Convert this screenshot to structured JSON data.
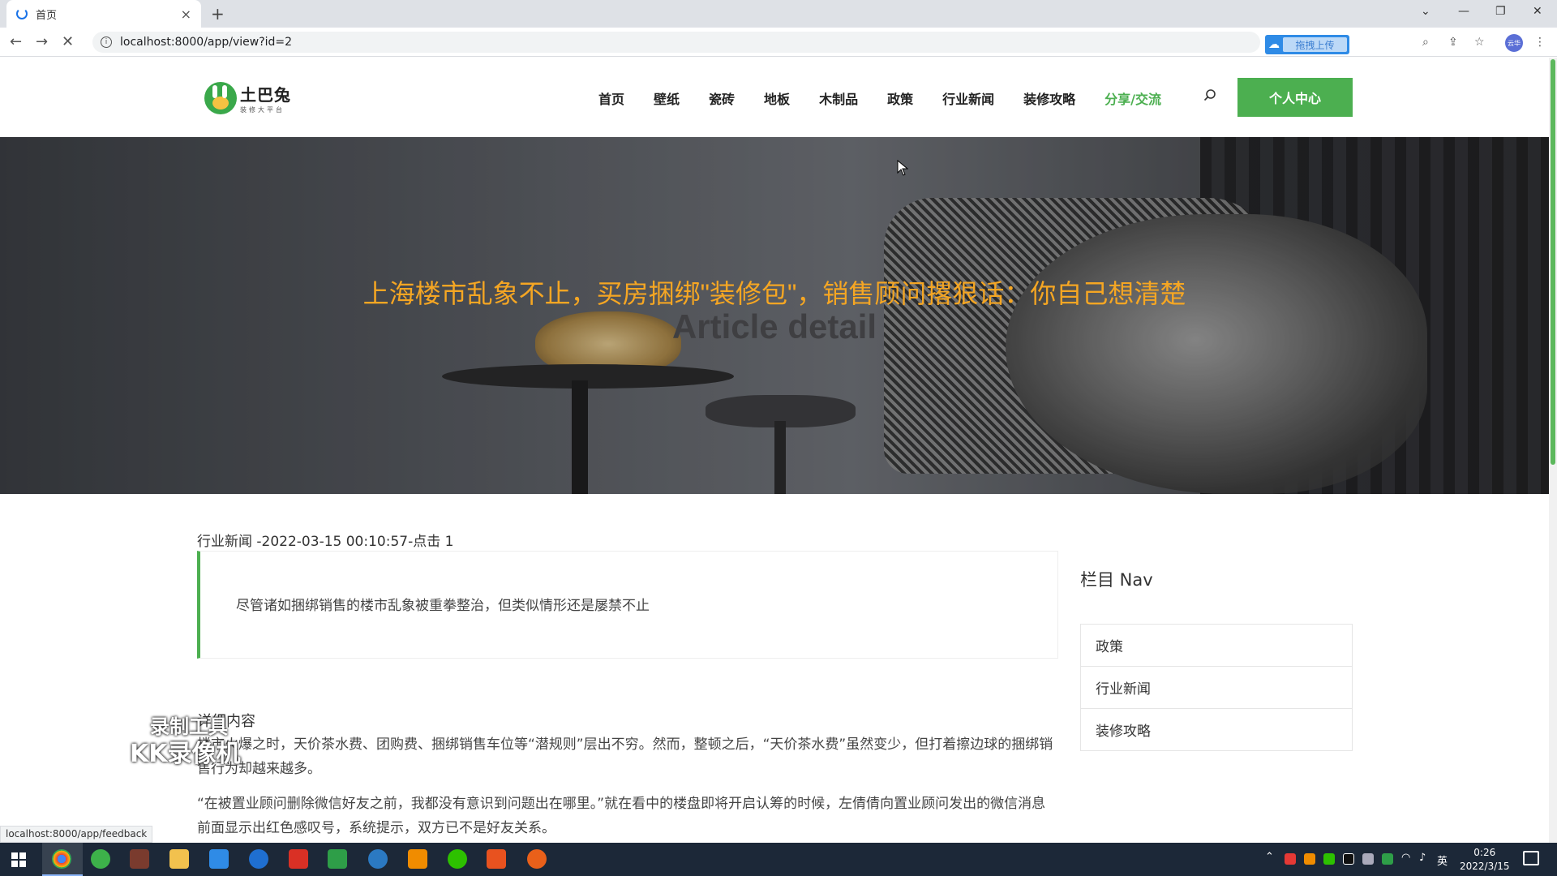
{
  "browser": {
    "tab_title": "首页",
    "tab_close": "×",
    "new_tab": "+",
    "url": "localhost:8000/app/view?id=2",
    "upload_label": "拖拽上传",
    "avatar_text": "云华",
    "status_url": "localhost:8000/app/feedback"
  },
  "site": {
    "logo_name": "土巴兔",
    "logo_sub": "装修大平台",
    "nav": [
      "首页",
      "壁纸",
      "瓷砖",
      "地板",
      "木制品",
      "政策",
      "行业新闻",
      "装修攻略",
      "分享/交流"
    ],
    "active_nav_color": "#4caf50",
    "user_center": "个人中心"
  },
  "hero": {
    "title": "上海楼市乱象不止，买房捆绑\"装修包\"，销售顾问撂狠话：你自己想清楚",
    "subtitle": "Article detail",
    "title_color": "#f5a623"
  },
  "article": {
    "meta": "行业新闻 -2022-03-15 00:10:57-点击 1",
    "summary": "尽管诸如捆绑销售的楼市乱象被重拳整治，但类似情形还是屡禁不止",
    "detail_label": "详细内容",
    "paragraphs": [
      "楼市火爆之时，天价茶水费、团购费、捆绑销售车位等“潜规则”层出不穷。然而，整顿之后，“天价茶水费”虽然变少，但打着擦边球的捆绑销售行为却越来越多。",
      "“在被置业顾问删除微信好友之前，我都没有意识到问题出在哪里。”就在看中的楼盘即将开启认筹的时候，左倩倩向置业顾问发出的微信消息前面显示出红色感叹号，系统提示，双方已不是好友关系。"
    ]
  },
  "sidebar": {
    "title": "栏目 Nav",
    "items": [
      "政策",
      "行业新闻",
      "装修攻略"
    ]
  },
  "watermark": {
    "line1": "录制工具",
    "line2": "KK录像机"
  },
  "taskbar": {
    "lang": "英",
    "time": "0:26",
    "date": "2022/3/15"
  }
}
